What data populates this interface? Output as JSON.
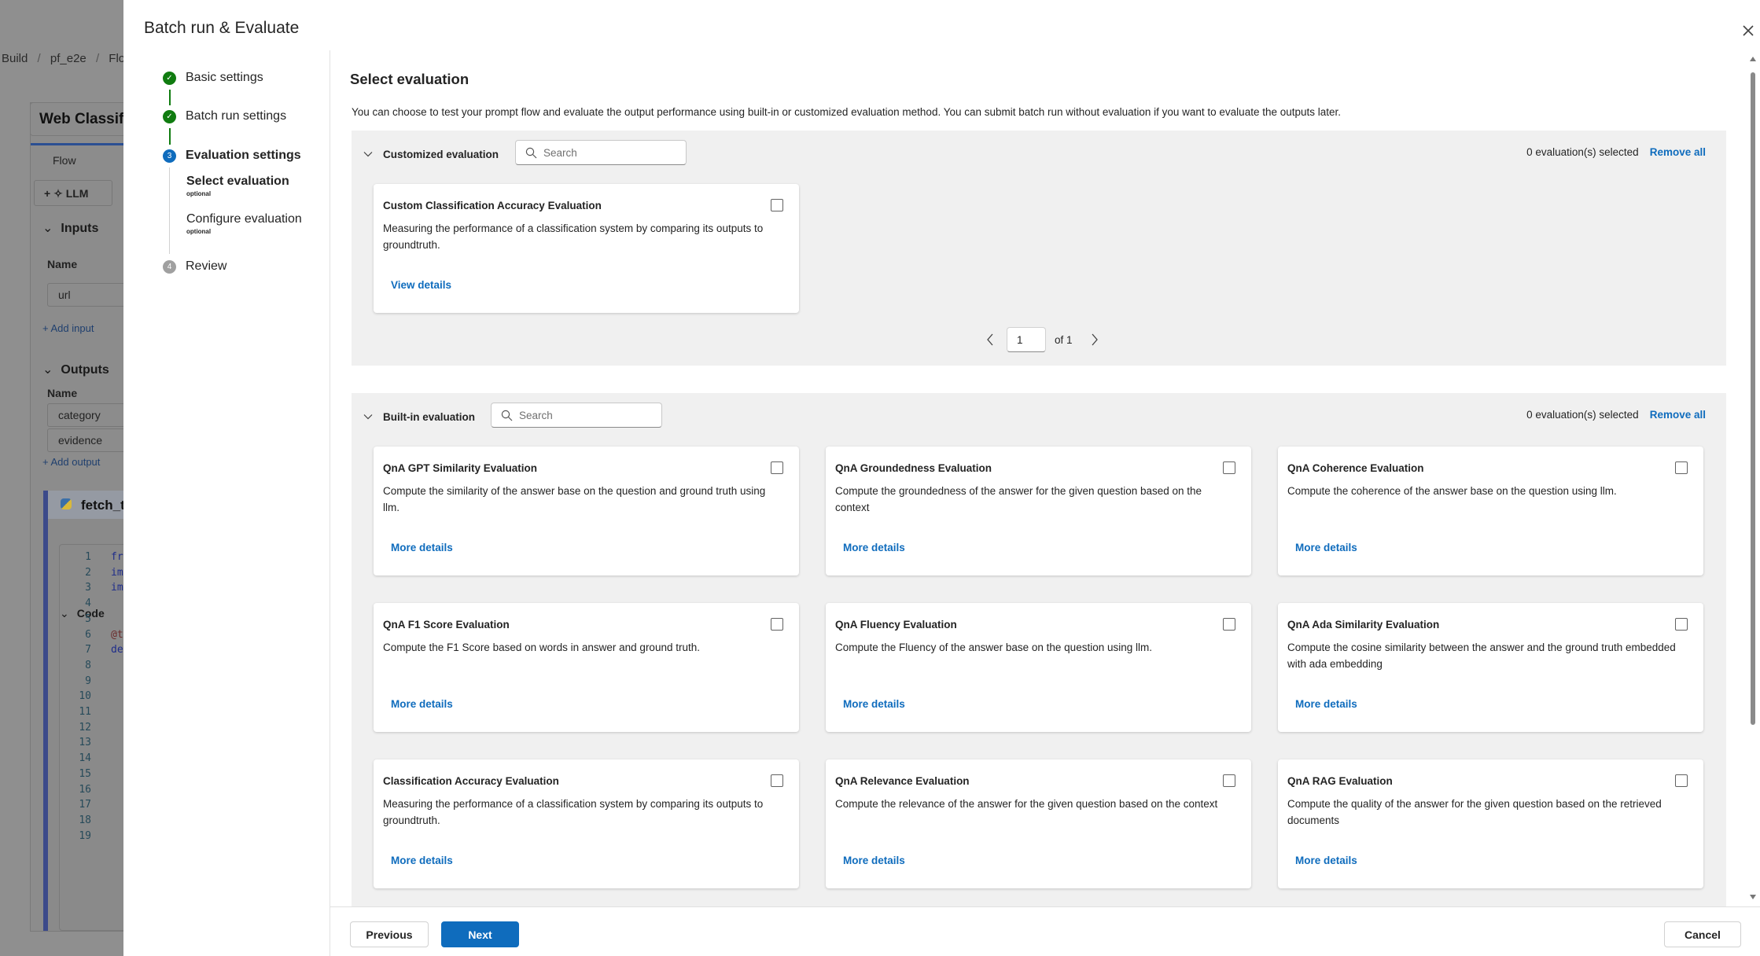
{
  "background_app": {
    "breadcrumb": [
      "Build",
      "pf_e2e",
      "Flow"
    ],
    "flow_title": "Web Classific",
    "tab": "Flow",
    "llm_button": "LLM",
    "inputs_heading": "Inputs",
    "inputs_name_label": "Name",
    "inputs": [
      "url"
    ],
    "add_input": "Add input",
    "outputs_heading": "Outputs",
    "outputs_name_label": "Name",
    "outputs": [
      "category",
      "evidence"
    ],
    "add_output": "Add output",
    "node_title": "fetch_t",
    "code_label": "Code",
    "code_snippets": [
      "fr",
      "im",
      "im",
      "",
      "",
      "@t",
      "de"
    ],
    "line_numbers": [
      "1",
      "2",
      "3",
      "4",
      "5",
      "6",
      "7",
      "8",
      "9",
      "10",
      "11",
      "12",
      "13",
      "14",
      "15",
      "16",
      "17",
      "18",
      "19"
    ]
  },
  "modal": {
    "title": "Batch run & Evaluate",
    "steps": [
      {
        "label": "Basic settings",
        "status": "complete"
      },
      {
        "label": "Batch run settings",
        "status": "complete"
      },
      {
        "label": "Evaluation settings",
        "status": "current",
        "number": "3"
      },
      {
        "label": "Review",
        "status": "pending",
        "number": "4"
      }
    ],
    "substeps": [
      {
        "label": "Select evaluation",
        "note": "optional",
        "active": true
      },
      {
        "label": "Configure evaluation",
        "note": "optional",
        "active": false
      }
    ],
    "heading": "Select evaluation",
    "description": "You can choose to test your prompt flow and evaluate the output performance using built-in or customized evaluation method. You can submit batch run without evaluation if you want to evaluate the outputs later.",
    "customized": {
      "label": "Customized evaluation",
      "search_placeholder": "Search",
      "selected_text": "0 evaluation(s) selected",
      "remove_all": "Remove all",
      "cards": [
        {
          "title": "Custom Classification Accuracy Evaluation",
          "description": "Measuring the performance of a classification system by comparing its outputs to groundtruth.",
          "link": "View details",
          "checked": false
        }
      ],
      "page": "1",
      "page_of": "of 1"
    },
    "builtin": {
      "label": "Built-in evaluation",
      "search_placeholder": "Search",
      "selected_text": "0 evaluation(s) selected",
      "remove_all": "Remove all",
      "cards": [
        {
          "title": "QnA GPT Similarity Evaluation",
          "description": "Compute the similarity of the answer base on the question and ground truth using llm.",
          "link": "More details",
          "checked": false
        },
        {
          "title": "QnA Groundedness Evaluation",
          "description": "Compute the groundedness of the answer for the given question based on the context",
          "link": "More details",
          "checked": false
        },
        {
          "title": "QnA Coherence Evaluation",
          "description": "Compute the coherence of the answer base on the question using llm.",
          "link": "More details",
          "checked": false
        },
        {
          "title": "QnA F1 Score Evaluation",
          "description": "Compute the F1 Score based on words in answer and ground truth.",
          "link": "More details",
          "checked": false
        },
        {
          "title": "QnA Fluency Evaluation",
          "description": "Compute the Fluency of the answer base on the question using llm.",
          "link": "More details",
          "checked": false
        },
        {
          "title": "QnA Ada Similarity Evaluation",
          "description": "Compute the cosine similarity between the answer and the ground truth embedded with ada embedding",
          "link": "More details",
          "checked": false
        },
        {
          "title": "Classification Accuracy Evaluation",
          "description": "Measuring the performance of a classification system by comparing its outputs to groundtruth.",
          "link": "More details",
          "checked": false
        },
        {
          "title": "QnA Relevance Evaluation",
          "description": "Compute the relevance of the answer for the given question based on the context",
          "link": "More details",
          "checked": false
        },
        {
          "title": "QnA RAG Evaluation",
          "description": "Compute the quality of the answer for the given question based on the retrieved documents",
          "link": "More details",
          "checked": false
        }
      ]
    },
    "footer": {
      "previous": "Previous",
      "next": "Next",
      "cancel": "Cancel"
    }
  },
  "colors": {
    "accent": "#0f6cbd",
    "complete": "#107c10",
    "section_bg": "#f0f0f0"
  }
}
